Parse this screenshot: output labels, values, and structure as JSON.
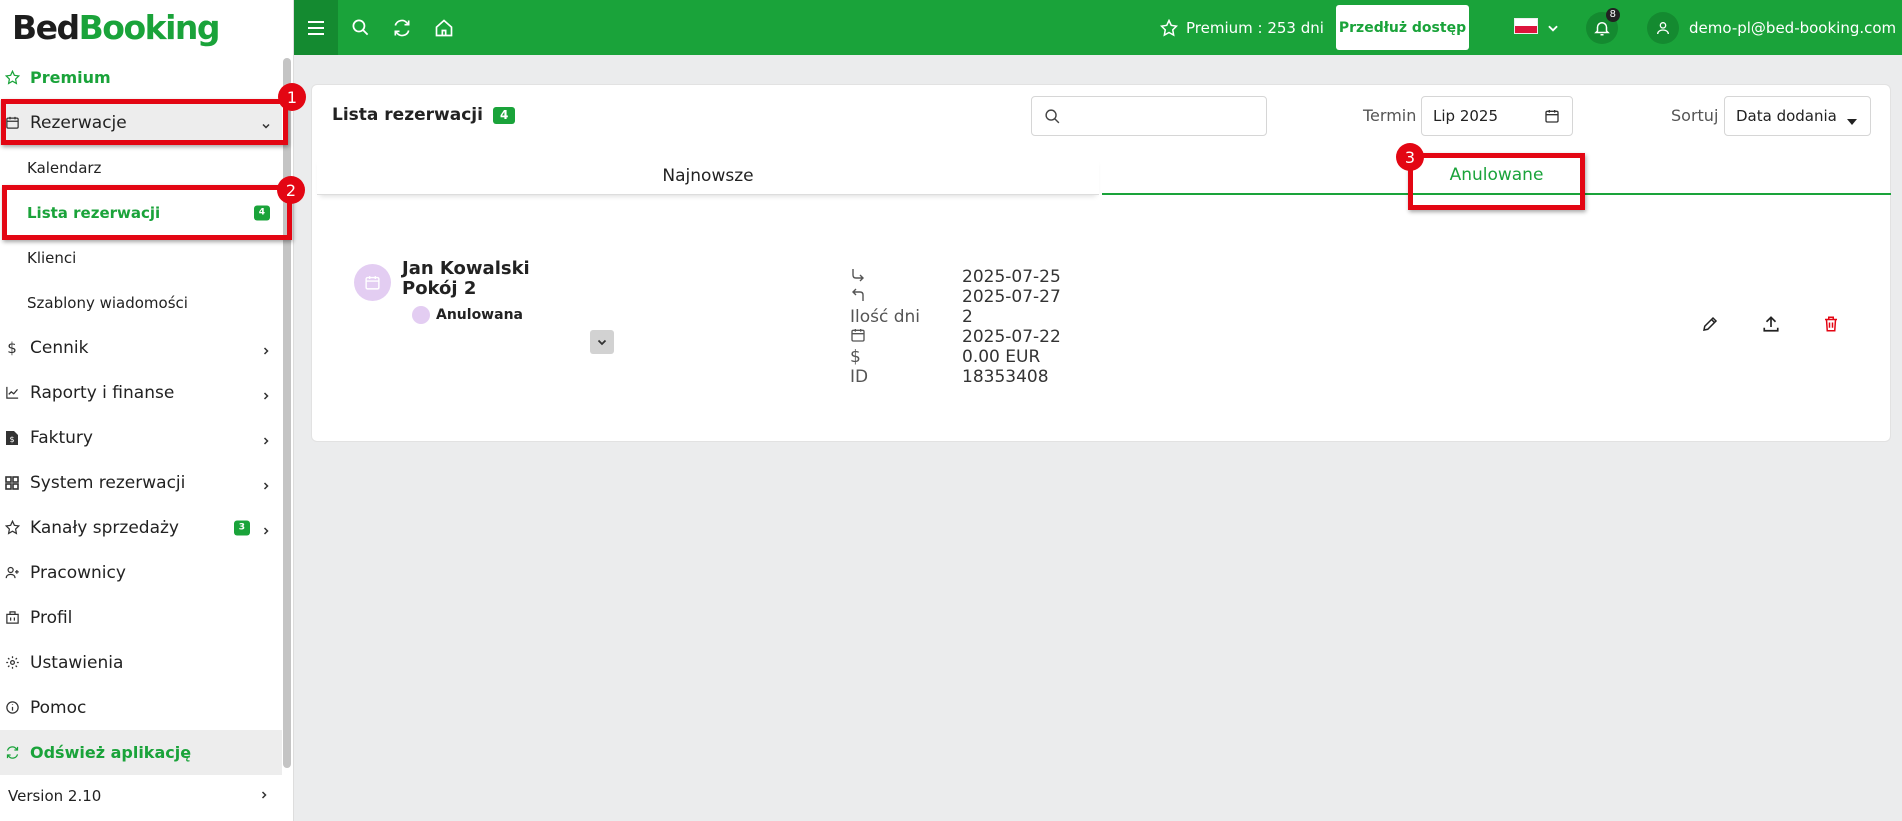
{
  "logo": {
    "part1": "Bed",
    "part2": "Booking"
  },
  "sidebar": {
    "premium": "Premium",
    "items": [
      {
        "label": "Rezerwacje",
        "icon": "calendar-icon"
      },
      {
        "label": "Kalendarz"
      },
      {
        "label": "Lista rezerwacji",
        "badge": "4"
      },
      {
        "label": "Klienci"
      },
      {
        "label": "Szablony wiadomości"
      },
      {
        "label": "Cennik",
        "icon": "dollar-icon"
      },
      {
        "label": "Raporty i finanse",
        "icon": "chart-icon"
      },
      {
        "label": "Faktury",
        "icon": "invoice-icon"
      },
      {
        "label": "System rezerwacji",
        "icon": "grid-icon"
      },
      {
        "label": "Kanały sprzedaży",
        "badge": "3",
        "icon": "star-icon"
      },
      {
        "label": "Pracownicy",
        "icon": "user-plus-icon"
      },
      {
        "label": "Profil",
        "icon": "building-icon"
      },
      {
        "label": "Ustawienia",
        "icon": "gear-icon"
      },
      {
        "label": "Pomoc",
        "icon": "info-icon"
      }
    ],
    "refresh": "Odśwież aplikację",
    "version": "Version 2.10"
  },
  "topbar": {
    "premium_text": "Premium : 253 dni",
    "extend_button": "Przedłuż dostęp",
    "notifications_count": "8",
    "user_email": "demo-pl@bed-booking.com"
  },
  "main": {
    "title": "Lista rezerwacji",
    "count_badge": "4",
    "search_placeholder": "",
    "term_label": "Termin",
    "term_value": "Lip 2025",
    "sort_label": "Sortuj",
    "sort_value": "Data dodania",
    "tabs": [
      {
        "label": "Najnowsze"
      },
      {
        "label": "Anulowane"
      }
    ],
    "reservation": {
      "name": "Jan Kowalski",
      "room": "Pokój 2",
      "status": "Anulowana",
      "details": [
        {
          "key": "↳",
          "value": "2025-07-25"
        },
        {
          "key": "↰",
          "value": "2025-07-27"
        },
        {
          "key": "Ilość dni",
          "value": "2"
        },
        {
          "key": "",
          "value": "2025-07-22"
        },
        {
          "key": "$",
          "value": "0.00 EUR"
        },
        {
          "key": "ID",
          "value": "18353408"
        }
      ]
    }
  },
  "annotations": [
    "1",
    "2",
    "3"
  ],
  "colors": {
    "brand": "#1aa33a",
    "annotation": "#e30613",
    "status_cancelled": "#e3cdf2",
    "delete": "#e30613"
  }
}
